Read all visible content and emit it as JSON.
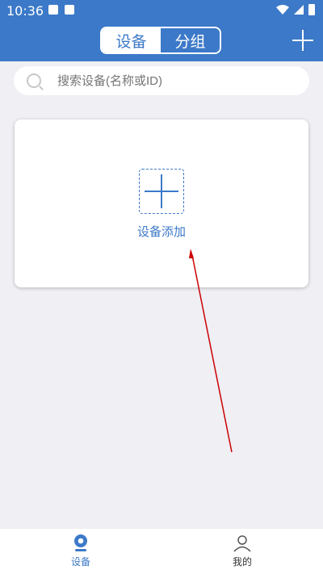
{
  "status": {
    "time": "10:36"
  },
  "header": {
    "tabs": [
      {
        "label": "设备",
        "selected": true
      },
      {
        "label": "分组",
        "selected": false
      }
    ]
  },
  "search": {
    "placeholder": "搜索设备(名称或ID)"
  },
  "card": {
    "add_label": "设备添加"
  },
  "bottom_nav": [
    {
      "label": "设备",
      "icon": "camera-icon",
      "selected": true
    },
    {
      "label": "我的",
      "icon": "user-icon",
      "selected": false
    }
  ],
  "colors": {
    "primary": "#3c79c8",
    "background": "#efeff4",
    "annotation": "#cc0000"
  }
}
